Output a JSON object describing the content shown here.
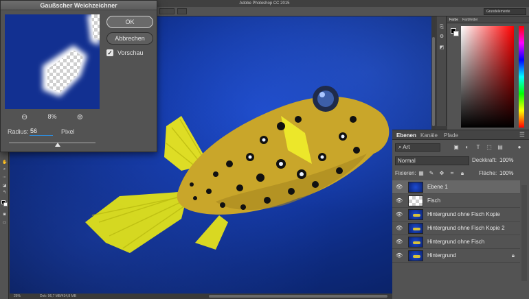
{
  "app": {
    "window_title": "Adobe Photoshop CC 2015",
    "workspace": "Grundelemente",
    "zoom": "25%",
    "doc_info": "Dok: 96,7 MB/434,8 MB"
  },
  "dialog": {
    "title": "Gaußscher Weichzeichner",
    "ok_label": "OK",
    "cancel_label": "Abbrechen",
    "preview_label": "Vorschau",
    "preview_checked": true,
    "zoom_out_icon": "zoom-out-icon",
    "zoom_in_icon": "zoom-in-icon",
    "zoom_percent": "8%",
    "radius_label": "Radius:",
    "radius_value": "56",
    "radius_unit": "Pixel",
    "slider_position": 0.56
  },
  "color_panel": {
    "tabs": [
      "Farbe",
      "Farbfelder"
    ],
    "foreground": "#000000",
    "background": "#ffffff"
  },
  "layers_panel": {
    "tabs": [
      "Ebenen",
      "Kanäle",
      "Pfade"
    ],
    "active_tab": "Ebenen",
    "filter_label": "Art",
    "blend_mode": "Normal",
    "opacity_label": "Deckkraft:",
    "opacity_value": "100%",
    "lock_label": "Fixieren:",
    "fill_label": "Fläche:",
    "fill_value": "100%",
    "layers": [
      {
        "name": "Ebene 1",
        "selected": true,
        "thumb": "blue",
        "locked": false
      },
      {
        "name": "Fisch",
        "selected": false,
        "thumb": "transparent",
        "locked": false
      },
      {
        "name": "Hintergrund ohne Fisch Kopie",
        "selected": false,
        "thumb": "fish",
        "locked": false
      },
      {
        "name": "Hintergrund ohne Fisch Kopie 2",
        "selected": false,
        "thumb": "fish",
        "locked": false
      },
      {
        "name": "Hintergrund ohne Fisch",
        "selected": false,
        "thumb": "fish",
        "locked": false
      },
      {
        "name": "Hintergrund",
        "selected": false,
        "thumb": "fish",
        "locked": true
      }
    ]
  },
  "colors": {
    "accent": "#2d8ee0",
    "fish_body": "#c9a62a",
    "fish_fin": "#e6e61a",
    "water": "#143aa8"
  }
}
